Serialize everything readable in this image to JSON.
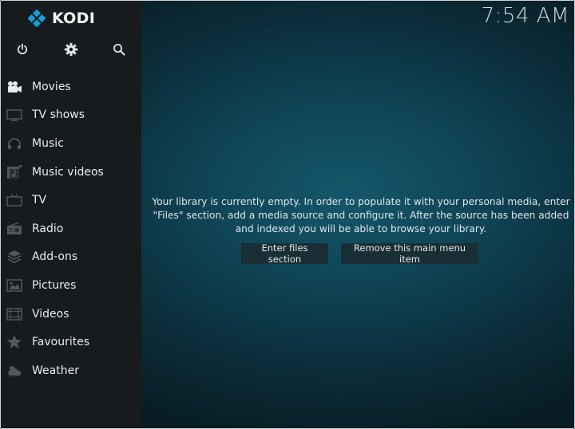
{
  "app": {
    "name": "KODI",
    "clock": "7:54 AM",
    "accent_color": "#12a0d7"
  },
  "top_icons": [
    {
      "name": "power-icon"
    },
    {
      "name": "gear-icon"
    },
    {
      "name": "search-icon"
    }
  ],
  "menu": [
    {
      "label": "Movies",
      "icon": "movie-camera-icon"
    },
    {
      "label": "TV shows",
      "icon": "monitor-icon"
    },
    {
      "label": "Music",
      "icon": "headphones-icon"
    },
    {
      "label": "Music videos",
      "icon": "music-video-icon"
    },
    {
      "label": "TV",
      "icon": "tv-icon"
    },
    {
      "label": "Radio",
      "icon": "radio-icon"
    },
    {
      "label": "Add-ons",
      "icon": "box-icon"
    },
    {
      "label": "Pictures",
      "icon": "picture-icon"
    },
    {
      "label": "Videos",
      "icon": "film-icon"
    },
    {
      "label": "Favourites",
      "icon": "star-icon"
    },
    {
      "label": "Weather",
      "icon": "weather-icon"
    }
  ],
  "main": {
    "message": "Your library is currently empty. In order to populate it with your personal media, enter \"Files\" section, add a media source and configure it. After the source has been added and indexed you will be able to browse your library.",
    "enter_files_label": "Enter files section",
    "remove_item_label": "Remove this main menu item"
  }
}
